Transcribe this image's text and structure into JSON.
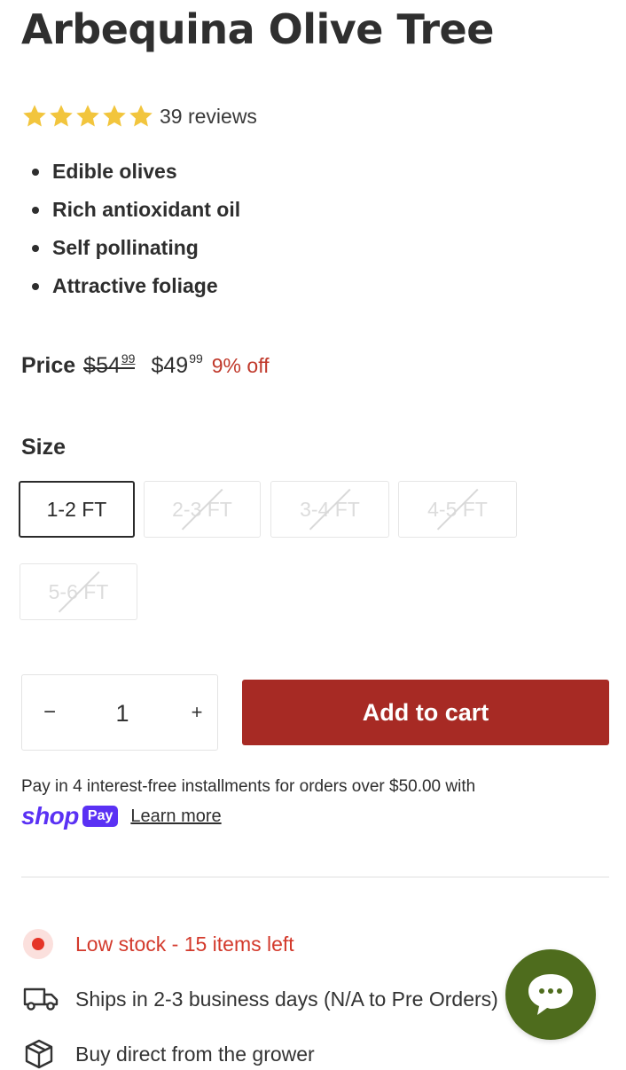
{
  "product": {
    "title": "Arbequina Olive Tree",
    "rating_stars": 5,
    "reviews": "39 reviews",
    "features": [
      "Edible olives",
      "Rich antioxidant oil",
      "Self pollinating",
      "Attractive foliage"
    ]
  },
  "price": {
    "label": "Price",
    "original_dollars": "$54",
    "original_cents": "99",
    "sale_dollars": "$49",
    "sale_cents": "99",
    "discount": "9% off"
  },
  "size": {
    "label": "Size",
    "options": [
      {
        "label": "1-2 FT",
        "available": true,
        "selected": true
      },
      {
        "label": "2-3 FT",
        "available": false,
        "selected": false
      },
      {
        "label": "3-4 FT",
        "available": false,
        "selected": false
      },
      {
        "label": "4-5 FT",
        "available": false,
        "selected": false
      },
      {
        "label": "5-6 FT",
        "available": false,
        "selected": false
      }
    ]
  },
  "quantity": {
    "minus": "−",
    "value": "1",
    "plus": "+"
  },
  "add_to_cart": "Add to cart",
  "installments": {
    "text": "Pay in 4 interest-free installments for orders over $50.00 with",
    "shop_word": "shop",
    "pay_badge": "Pay",
    "learn_more": "Learn more"
  },
  "info": {
    "stock": "Low stock - 15 items left",
    "shipping": "Ships in 2-3 business days (N/A to Pre Orders)",
    "grower": "Buy direct from the grower"
  },
  "colors": {
    "accent": "#a72a24",
    "star": "#f2c53d",
    "stock_red": "#d33a2c",
    "shop_purple": "#5a31f4",
    "chat_green": "#4e6c1d"
  },
  "icons": {
    "star": "star-icon",
    "stock": "stock-dot-icon",
    "truck": "truck-icon",
    "box": "box-icon",
    "chat": "chat-icon"
  }
}
